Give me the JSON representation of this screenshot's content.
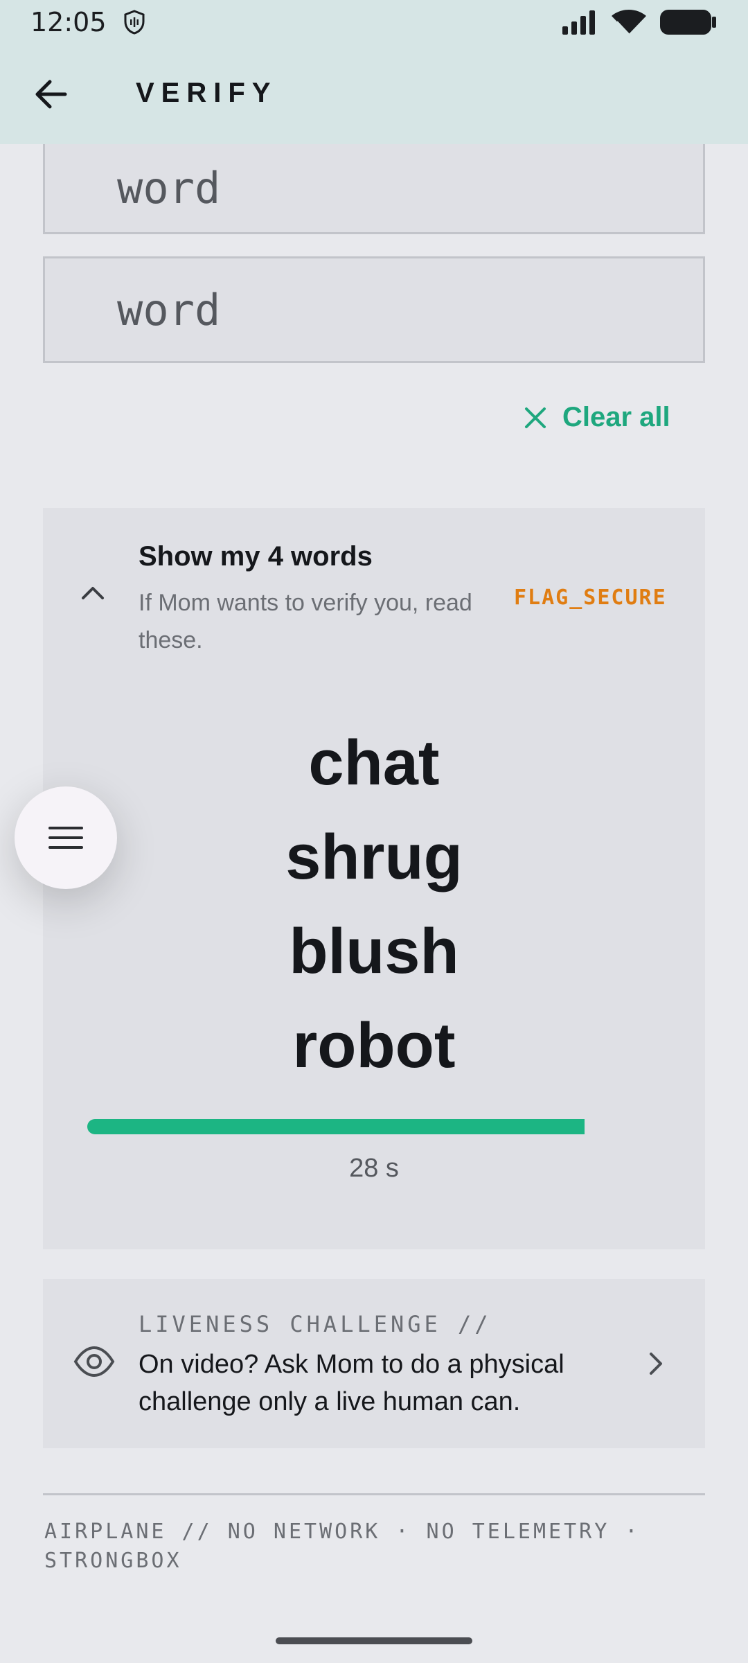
{
  "status_bar": {
    "time": "12:05"
  },
  "app_bar": {
    "title": "VERIFY"
  },
  "fields": [
    {
      "placeholder": "word"
    },
    {
      "placeholder": "word"
    }
  ],
  "clear_all": {
    "label": "Clear all"
  },
  "show_words_card": {
    "heading": "Show my 4 words",
    "subtitle": "If Mom wants to verify you, read these.",
    "flag": "FLAG_SECURE",
    "words": [
      "chat",
      "shrug",
      "blush",
      "robot"
    ],
    "timer_label": "28 s",
    "timer_fraction": 0.93,
    "accent_color": "#1cb583"
  },
  "liveness_card": {
    "kicker": "LIVENESS CHALLENGE //",
    "text": "On video? Ask Mom to do a physical challenge only a live human can."
  },
  "footer": {
    "text": "AIRPLANE // NO NETWORK · NO TELEMETRY · STRONGBOX"
  },
  "icons": {
    "back": "arrow-left-icon",
    "clear": "close-icon",
    "collapse": "chevron-up-icon",
    "menu": "hamburger-icon",
    "eye": "eye-icon",
    "open": "chevron-right-icon"
  }
}
